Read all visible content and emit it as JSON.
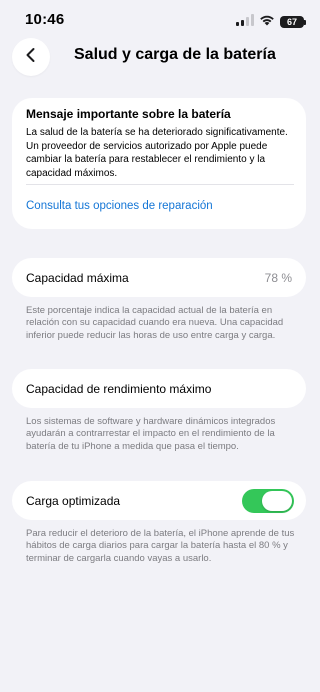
{
  "status_bar": {
    "time": "10:46",
    "battery": "67",
    "icons": [
      "signal-icon",
      "wifi-icon",
      "battery-icon"
    ]
  },
  "nav": {
    "title": "Salud y carga de la batería",
    "back_icon": "chevron-left-icon"
  },
  "message_card": {
    "title": "Mensaje importante sobre la batería",
    "body": "La salud de la batería se ha deteriorado significativamente. Un proveedor de servicios autorizado por Apple puede cambiar la batería para restablecer el rendimiento y la capacidad máximos.",
    "link": "Consulta tus opciones de reparación"
  },
  "capacity": {
    "label": "Capacidad máxima",
    "value": "78 %",
    "footnote": "Este porcentaje indica la capacidad actual de la batería en relación con su capacidad cuando era nueva. Una capacidad inferior puede reducir las horas de uso entre carga y carga."
  },
  "performance": {
    "label": "Capacidad de rendimiento máximo",
    "footnote": "Los sistemas de software y hardware dinámicos integrados ayudarán a contrarrestar el impacto en el rendimiento de la batería de tu iPhone a medida que pasa el tiempo."
  },
  "optimized": {
    "label": "Carga optimizada",
    "enabled": true,
    "footnote": "Para reducir el deterioro de la batería, el iPhone aprende de tus hábitos de carga diarios para cargar la batería hasta el 80 % y terminar de cargarla cuando vayas a usarlo."
  },
  "colors": {
    "background": "#f2f2f7",
    "link": "#1476d6",
    "toggle_on": "#34c759",
    "secondary_text": "#8e8e93"
  }
}
